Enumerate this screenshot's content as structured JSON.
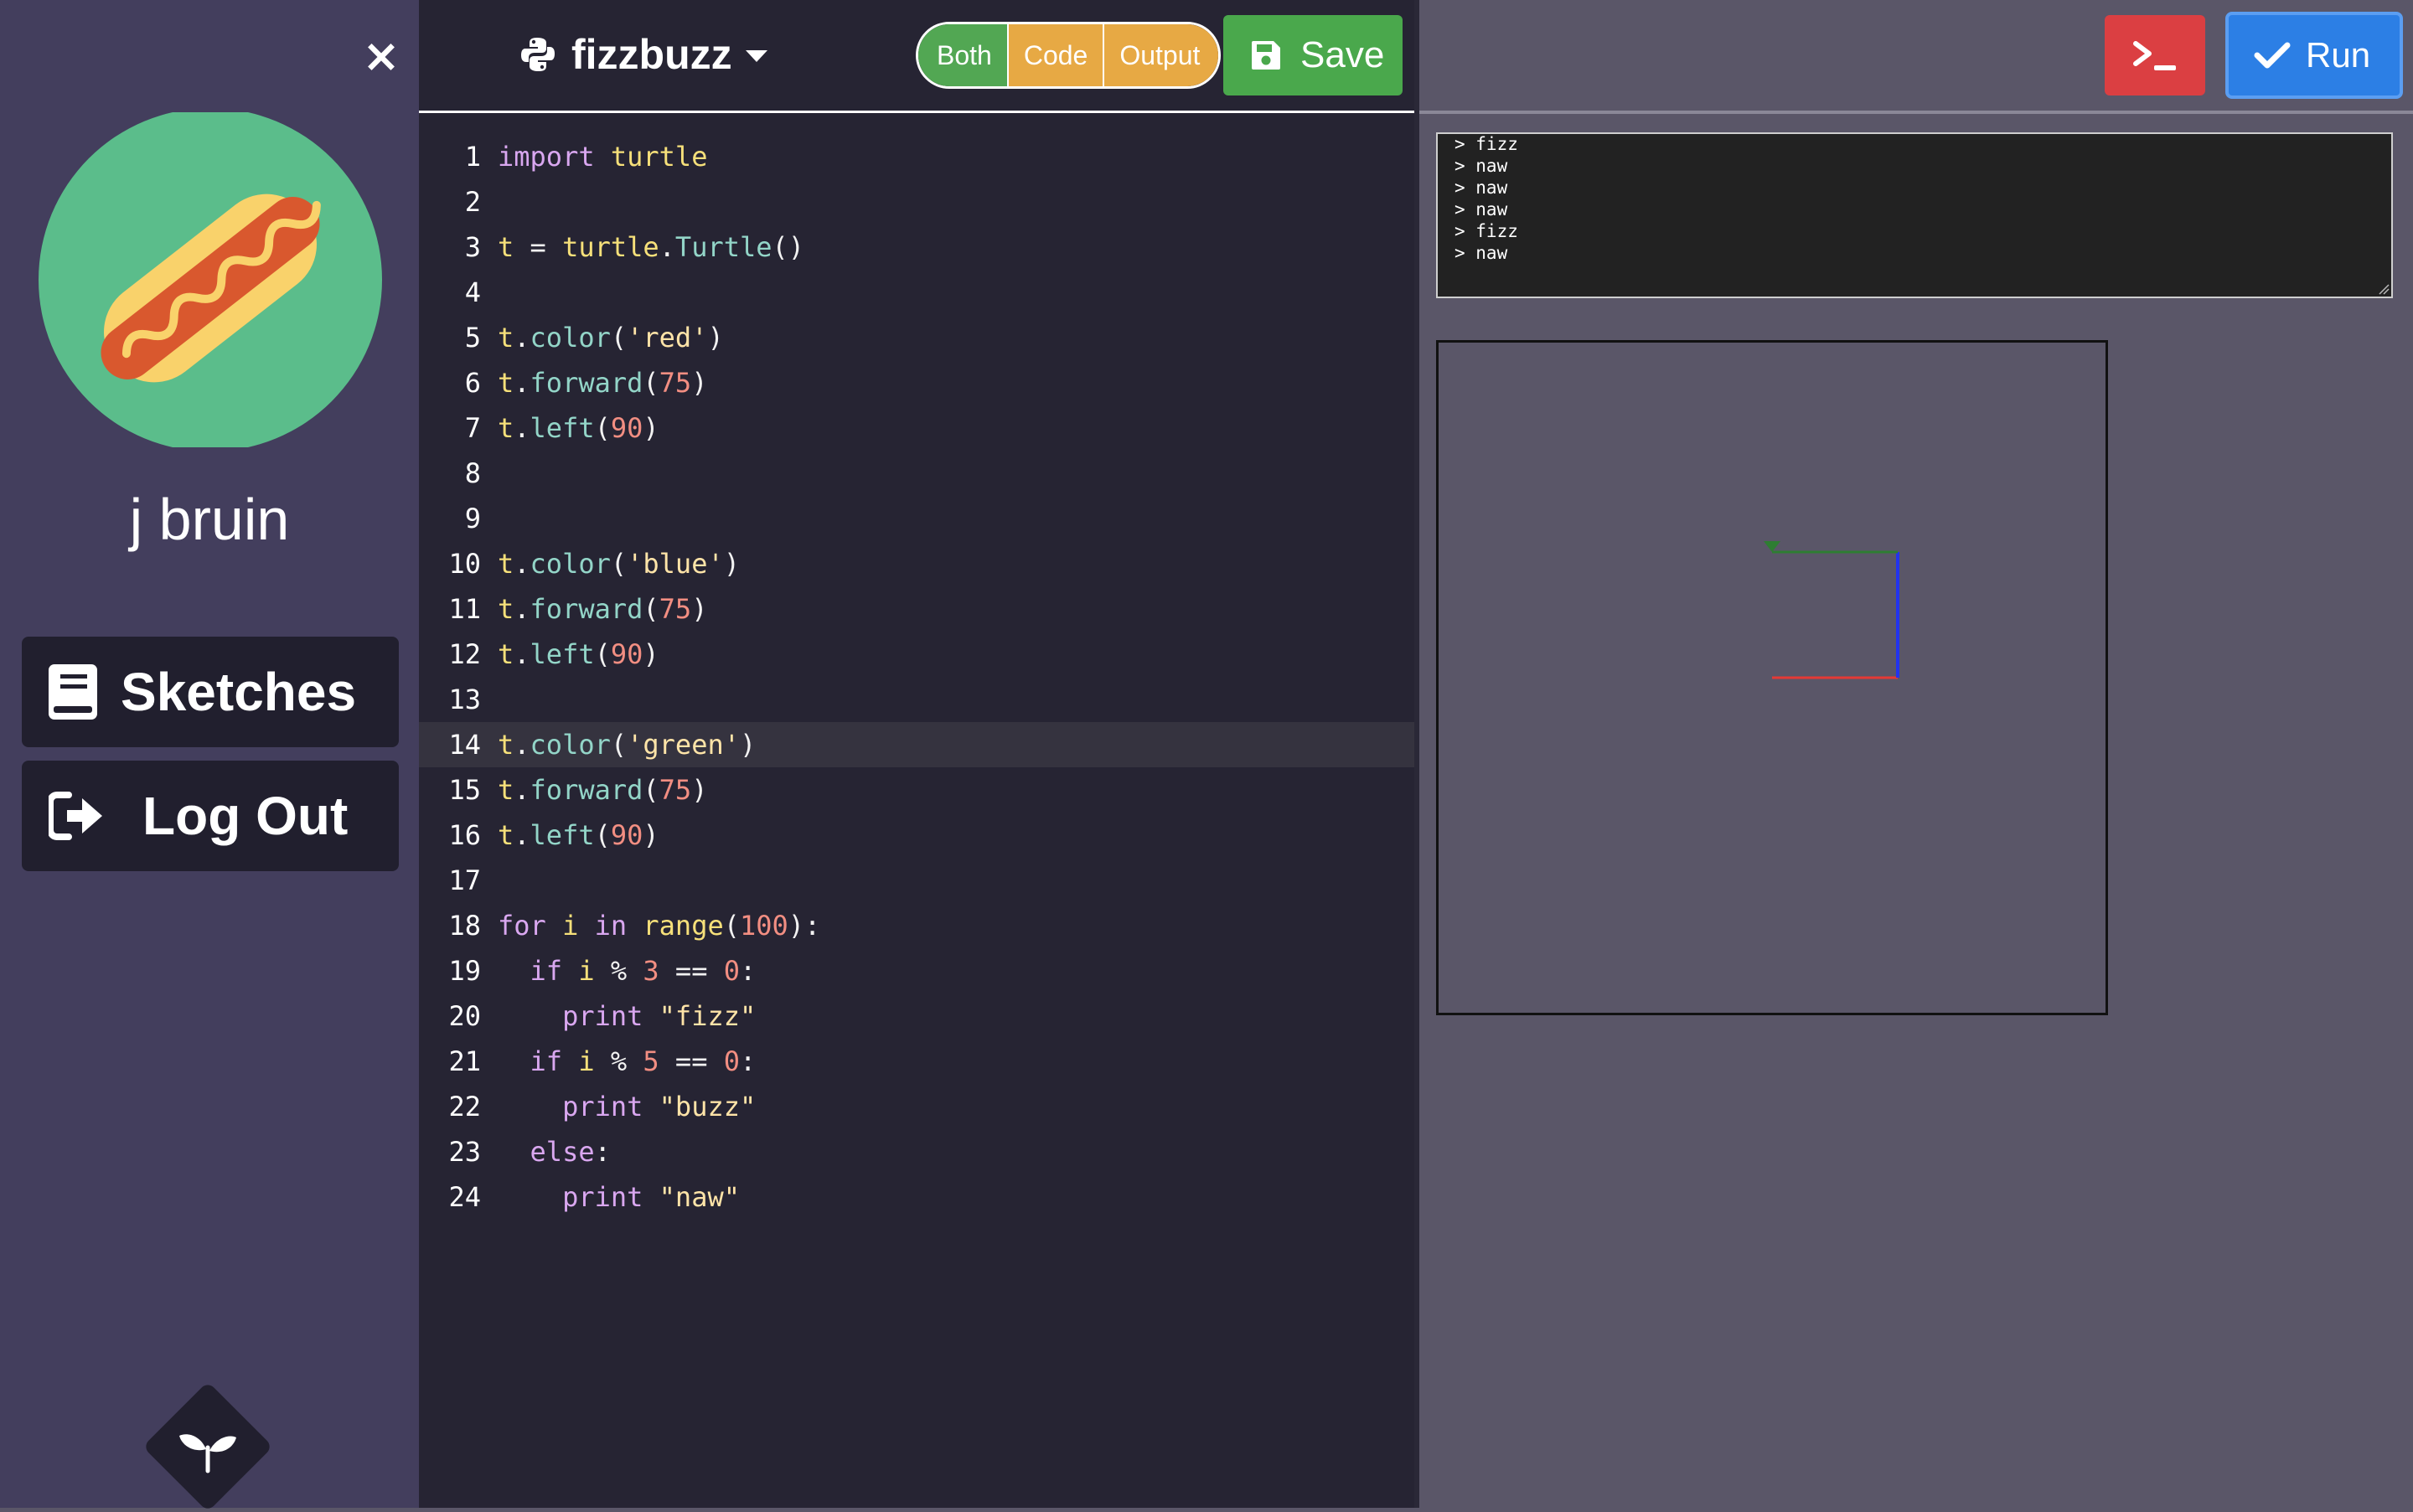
{
  "sidebar": {
    "close_label": "×",
    "username": "j bruin",
    "sketches_label": "Sketches",
    "logout_label": "Log Out"
  },
  "editor": {
    "filename": "fizzbuzz",
    "mode_both": "Both",
    "mode_code": "Code",
    "mode_output": "Output",
    "save_label": "Save",
    "active_line": 14,
    "lines": [
      "import turtle",
      "",
      "t = turtle.Turtle()",
      "",
      "t.color('red')",
      "t.forward(75)",
      "t.left(90)",
      "",
      "",
      "t.color('blue')",
      "t.forward(75)",
      "t.left(90)",
      "",
      "t.color('green')",
      "t.forward(75)",
      "t.left(90)",
      "",
      "for i in range(100):",
      "  if i % 3 == 0:",
      "    print \"fizz\"",
      "  if i % 5 == 0:",
      "    print \"buzz\"",
      "  else:",
      "    print \"naw\""
    ]
  },
  "output": {
    "run_label": "Run",
    "console_lines": [
      "> fizz",
      "> naw",
      "> naw",
      "> naw",
      "> fizz",
      "> naw"
    ]
  },
  "colors": {
    "sidebar_bg": "#433e5d",
    "editor_bg": "#262433",
    "output_bg": "#5a5668",
    "save_green": "#4aa84c",
    "run_blue": "#2c7fe5",
    "console_red": "#db3f42",
    "toggle_orange": "#e7a944"
  },
  "icons": {
    "close": "close-icon",
    "avatar": "hotdog-avatar",
    "sketches": "book-icon",
    "logout": "sign-out-icon",
    "logo": "sprout-icon",
    "language": "python-icon",
    "save": "floppy-disk-icon",
    "console": "terminal-icon",
    "run": "checkmark-icon"
  }
}
